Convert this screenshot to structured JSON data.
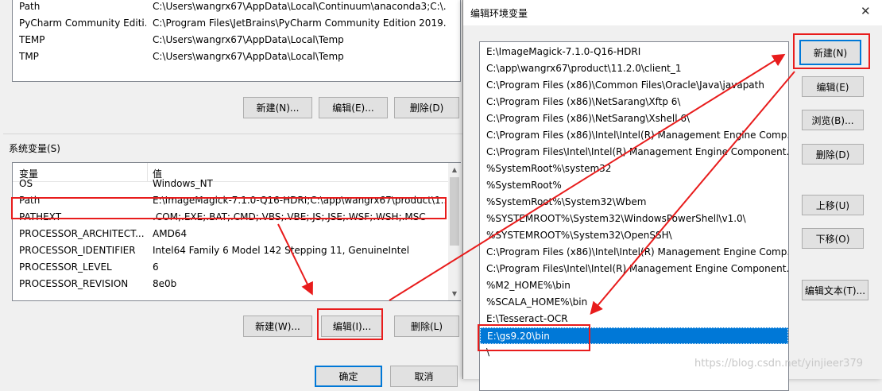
{
  "user_vars": {
    "rows": [
      {
        "name": "Path",
        "value": "C:\\Users\\wangrx67\\AppData\\Local\\Continuum\\anaconda3;C:\\..."
      },
      {
        "name": "PyCharm Community Editi...",
        "value": "C:\\Program Files\\JetBrains\\PyCharm Community Edition 2019...."
      },
      {
        "name": "TEMP",
        "value": "C:\\Users\\wangrx67\\AppData\\Local\\Temp"
      },
      {
        "name": "TMP",
        "value": "C:\\Users\\wangrx67\\AppData\\Local\\Temp"
      }
    ],
    "buttons": {
      "new": "新建(N)...",
      "edit": "编辑(E)...",
      "delete": "删除(D)"
    }
  },
  "system_vars": {
    "label": "系统变量(S)",
    "headers": {
      "name": "变量",
      "value": "值"
    },
    "rows": [
      {
        "name": "OS",
        "value": "Windows_NT"
      },
      {
        "name": "Path",
        "value": "E:\\ImageMagick-7.1.0-Q16-HDRI;C:\\app\\wangrx67\\product\\1..."
      },
      {
        "name": "PATHEXT",
        "value": ".COM;.EXE;.BAT;.CMD;.VBS;.VBE;.JS;.JSE;.WSF;.WSH;.MSC"
      },
      {
        "name": "PROCESSOR_ARCHITECT...",
        "value": "AMD64"
      },
      {
        "name": "PROCESSOR_IDENTIFIER",
        "value": "Intel64 Family 6 Model 142 Stepping 11, GenuineIntel"
      },
      {
        "name": "PROCESSOR_LEVEL",
        "value": "6"
      },
      {
        "name": "PROCESSOR_REVISION",
        "value": "8e0b"
      }
    ],
    "buttons": {
      "new": "新建(W)...",
      "edit": "编辑(I)...",
      "delete": "删除(L)"
    }
  },
  "footer": {
    "ok": "确定",
    "cancel": "取消"
  },
  "dialog": {
    "title": "编辑环境变量",
    "close_glyph": "✕",
    "entries": [
      "E:\\ImageMagick-7.1.0-Q16-HDRI",
      "C:\\app\\wangrx67\\product\\11.2.0\\client_1",
      "C:\\Program Files (x86)\\Common Files\\Oracle\\Java\\javapath",
      "C:\\Program Files (x86)\\NetSarang\\Xftp 6\\",
      "C:\\Program Files (x86)\\NetSarang\\Xshell 6\\",
      "C:\\Program Files (x86)\\Intel\\Intel(R) Management Engine Comp...",
      "C:\\Program Files\\Intel\\Intel(R) Management Engine Component...",
      "%SystemRoot%\\system32",
      "%SystemRoot%",
      "%SystemRoot%\\System32\\Wbem",
      "%SYSTEMROOT%\\System32\\WindowsPowerShell\\v1.0\\",
      "%SYSTEMROOT%\\System32\\OpenSSH\\",
      "C:\\Program Files (x86)\\Intel\\Intel(R) Management Engine Comp...",
      "C:\\Program Files\\Intel\\Intel(R) Management Engine Component...",
      "%M2_HOME%\\bin",
      "%SCALA_HOME%\\bin",
      "E:\\Tesseract-OCR",
      "E:\\gs9.20\\bin",
      "\\"
    ],
    "selected_index": 17,
    "buttons": {
      "new": "新建(N)",
      "edit": "编辑(E)",
      "browse": "浏览(B)...",
      "delete": "删除(D)",
      "up": "上移(U)",
      "down": "下移(O)",
      "edit_text": "编辑文本(T)..."
    }
  },
  "watermark": "https://blog.csdn.net/yinjieer379",
  "colors": {
    "accent": "#0078d7",
    "annotation": "#e81c1c"
  }
}
